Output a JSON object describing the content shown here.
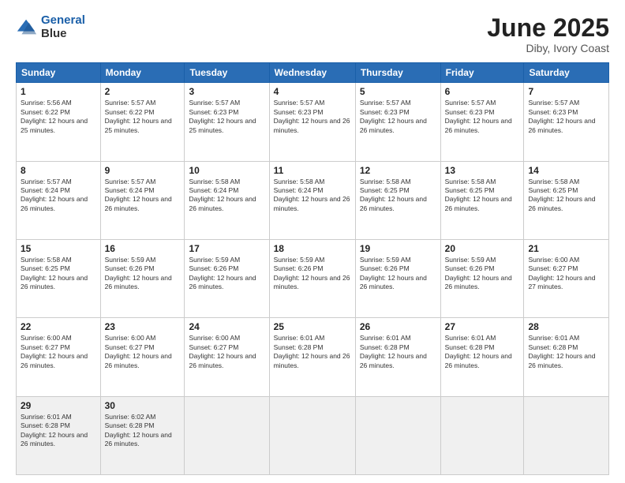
{
  "header": {
    "logo_line1": "General",
    "logo_line2": "Blue",
    "title": "June 2025",
    "subtitle": "Diby, Ivory Coast"
  },
  "weekdays": [
    "Sunday",
    "Monday",
    "Tuesday",
    "Wednesday",
    "Thursday",
    "Friday",
    "Saturday"
  ],
  "weeks": [
    [
      {
        "day": "1",
        "sunrise": "5:56 AM",
        "sunset": "6:22 PM",
        "daylight": "12 hours and 25 minutes."
      },
      {
        "day": "2",
        "sunrise": "5:57 AM",
        "sunset": "6:22 PM",
        "daylight": "12 hours and 25 minutes."
      },
      {
        "day": "3",
        "sunrise": "5:57 AM",
        "sunset": "6:23 PM",
        "daylight": "12 hours and 25 minutes."
      },
      {
        "day": "4",
        "sunrise": "5:57 AM",
        "sunset": "6:23 PM",
        "daylight": "12 hours and 26 minutes."
      },
      {
        "day": "5",
        "sunrise": "5:57 AM",
        "sunset": "6:23 PM",
        "daylight": "12 hours and 26 minutes."
      },
      {
        "day": "6",
        "sunrise": "5:57 AM",
        "sunset": "6:23 PM",
        "daylight": "12 hours and 26 minutes."
      },
      {
        "day": "7",
        "sunrise": "5:57 AM",
        "sunset": "6:23 PM",
        "daylight": "12 hours and 26 minutes."
      }
    ],
    [
      {
        "day": "8",
        "sunrise": "5:57 AM",
        "sunset": "6:24 PM",
        "daylight": "12 hours and 26 minutes."
      },
      {
        "day": "9",
        "sunrise": "5:57 AM",
        "sunset": "6:24 PM",
        "daylight": "12 hours and 26 minutes."
      },
      {
        "day": "10",
        "sunrise": "5:58 AM",
        "sunset": "6:24 PM",
        "daylight": "12 hours and 26 minutes."
      },
      {
        "day": "11",
        "sunrise": "5:58 AM",
        "sunset": "6:24 PM",
        "daylight": "12 hours and 26 minutes."
      },
      {
        "day": "12",
        "sunrise": "5:58 AM",
        "sunset": "6:25 PM",
        "daylight": "12 hours and 26 minutes."
      },
      {
        "day": "13",
        "sunrise": "5:58 AM",
        "sunset": "6:25 PM",
        "daylight": "12 hours and 26 minutes."
      },
      {
        "day": "14",
        "sunrise": "5:58 AM",
        "sunset": "6:25 PM",
        "daylight": "12 hours and 26 minutes."
      }
    ],
    [
      {
        "day": "15",
        "sunrise": "5:58 AM",
        "sunset": "6:25 PM",
        "daylight": "12 hours and 26 minutes."
      },
      {
        "day": "16",
        "sunrise": "5:59 AM",
        "sunset": "6:26 PM",
        "daylight": "12 hours and 26 minutes."
      },
      {
        "day": "17",
        "sunrise": "5:59 AM",
        "sunset": "6:26 PM",
        "daylight": "12 hours and 26 minutes."
      },
      {
        "day": "18",
        "sunrise": "5:59 AM",
        "sunset": "6:26 PM",
        "daylight": "12 hours and 26 minutes."
      },
      {
        "day": "19",
        "sunrise": "5:59 AM",
        "sunset": "6:26 PM",
        "daylight": "12 hours and 26 minutes."
      },
      {
        "day": "20",
        "sunrise": "5:59 AM",
        "sunset": "6:26 PM",
        "daylight": "12 hours and 26 minutes."
      },
      {
        "day": "21",
        "sunrise": "6:00 AM",
        "sunset": "6:27 PM",
        "daylight": "12 hours and 27 minutes."
      }
    ],
    [
      {
        "day": "22",
        "sunrise": "6:00 AM",
        "sunset": "6:27 PM",
        "daylight": "12 hours and 26 minutes."
      },
      {
        "day": "23",
        "sunrise": "6:00 AM",
        "sunset": "6:27 PM",
        "daylight": "12 hours and 26 minutes."
      },
      {
        "day": "24",
        "sunrise": "6:00 AM",
        "sunset": "6:27 PM",
        "daylight": "12 hours and 26 minutes."
      },
      {
        "day": "25",
        "sunrise": "6:01 AM",
        "sunset": "6:28 PM",
        "daylight": "12 hours and 26 minutes."
      },
      {
        "day": "26",
        "sunrise": "6:01 AM",
        "sunset": "6:28 PM",
        "daylight": "12 hours and 26 minutes."
      },
      {
        "day": "27",
        "sunrise": "6:01 AM",
        "sunset": "6:28 PM",
        "daylight": "12 hours and 26 minutes."
      },
      {
        "day": "28",
        "sunrise": "6:01 AM",
        "sunset": "6:28 PM",
        "daylight": "12 hours and 26 minutes."
      }
    ],
    [
      {
        "day": "29",
        "sunrise": "6:01 AM",
        "sunset": "6:28 PM",
        "daylight": "12 hours and 26 minutes."
      },
      {
        "day": "30",
        "sunrise": "6:02 AM",
        "sunset": "6:28 PM",
        "daylight": "12 hours and 26 minutes."
      },
      null,
      null,
      null,
      null,
      null
    ]
  ]
}
